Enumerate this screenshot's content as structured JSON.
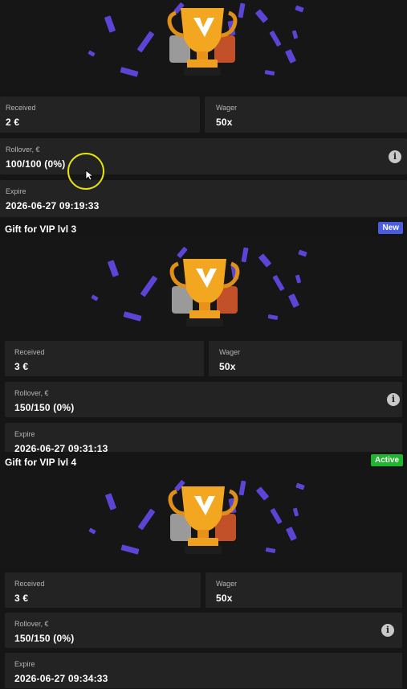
{
  "colors": {
    "background": "#151515",
    "card": "#232323",
    "confetti": "#5b44d6",
    "badge_new": "#4a5de0",
    "badge_active": "#1fb52e"
  },
  "gifts": [
    {
      "title": "",
      "received_label": "Received",
      "received_value": "2 €",
      "wager_label": "Wager",
      "wager_value": "50x",
      "rollover_label": "Rollover, €",
      "rollover_value": "100/100 (0%)",
      "expire_label": "Expire",
      "expire_value": "2026-06-27 09:19:33",
      "info_icon": "i"
    },
    {
      "title": "Gift for VIP lvl 3",
      "badge": "New",
      "received_label": "Received",
      "received_value": "3 €",
      "wager_label": "Wager",
      "wager_value": "50x",
      "rollover_label": "Rollover, €",
      "rollover_value": "150/150 (0%)",
      "expire_label": "Expire",
      "expire_value": "2026-06-27 09:31:13",
      "info_icon": "i"
    },
    {
      "title": "Gift for VIP lvl 4",
      "badge": "Active",
      "received_label": "Received",
      "received_value": "3 €",
      "wager_label": "Wager",
      "wager_value": "50x",
      "rollover_label": "Rollover, €",
      "rollover_value": "150/150 (0%)",
      "expire_label": "Expire",
      "expire_value": "2026-06-27 09:34:33",
      "info_icon": "i"
    }
  ]
}
